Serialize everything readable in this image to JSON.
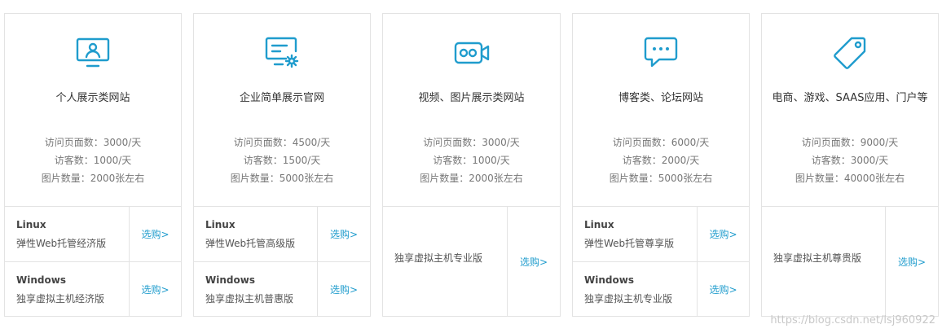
{
  "accent_color": "#1f9ccd",
  "cards": [
    {
      "icon": "monitor-user-icon",
      "title": "个人展示类网站",
      "stats": [
        "访问页面数：3000/天",
        "访客数：1000/天",
        "图片数量：2000张左右"
      ],
      "plans": [
        {
          "os": "Linux",
          "desc": "弹性Web托管经济版",
          "buy": "选购>"
        },
        {
          "os": "Windows",
          "desc": "独享虚拟主机经济版",
          "buy": "选购>"
        }
      ]
    },
    {
      "icon": "monitor-gear-icon",
      "title": "企业简单展示官网",
      "stats": [
        "访问页面数：4500/天",
        "访客数：1500/天",
        "图片数量：5000张左右"
      ],
      "plans": [
        {
          "os": "Linux",
          "desc": "弹性Web托管高级版",
          "buy": "选购>"
        },
        {
          "os": "Windows",
          "desc": "独享虚拟主机普惠版",
          "buy": "选购>"
        }
      ]
    },
    {
      "icon": "video-camera-icon",
      "title": "视频、图片展示类网站",
      "stats": [
        "访问页面数：3000/天",
        "访客数：1000/天",
        "图片数量：2000张左右"
      ],
      "plans": [
        {
          "desc": "独享虚拟主机专业版",
          "buy": "选购>"
        }
      ]
    },
    {
      "icon": "chat-bubble-icon",
      "title": "博客类、论坛网站",
      "stats": [
        "访问页面数：6000/天",
        "访客数：2000/天",
        "图片数量：5000张左右"
      ],
      "plans": [
        {
          "os": "Linux",
          "desc": "弹性Web托管尊享版",
          "buy": "选购>"
        },
        {
          "os": "Windows",
          "desc": "独享虚拟主机专业版",
          "buy": "选购>"
        }
      ]
    },
    {
      "icon": "price-tag-icon",
      "title": "电商、游戏、SAAS应用、门户等",
      "stats": [
        "访问页面数：9000/天",
        "访客数：3000/天",
        "图片数量：40000张左右"
      ],
      "plans": [
        {
          "desc": "独享虚拟主机尊贵版",
          "buy": "选购>"
        }
      ]
    }
  ],
  "watermark": "https://blog.csdn.net/lsj960922"
}
